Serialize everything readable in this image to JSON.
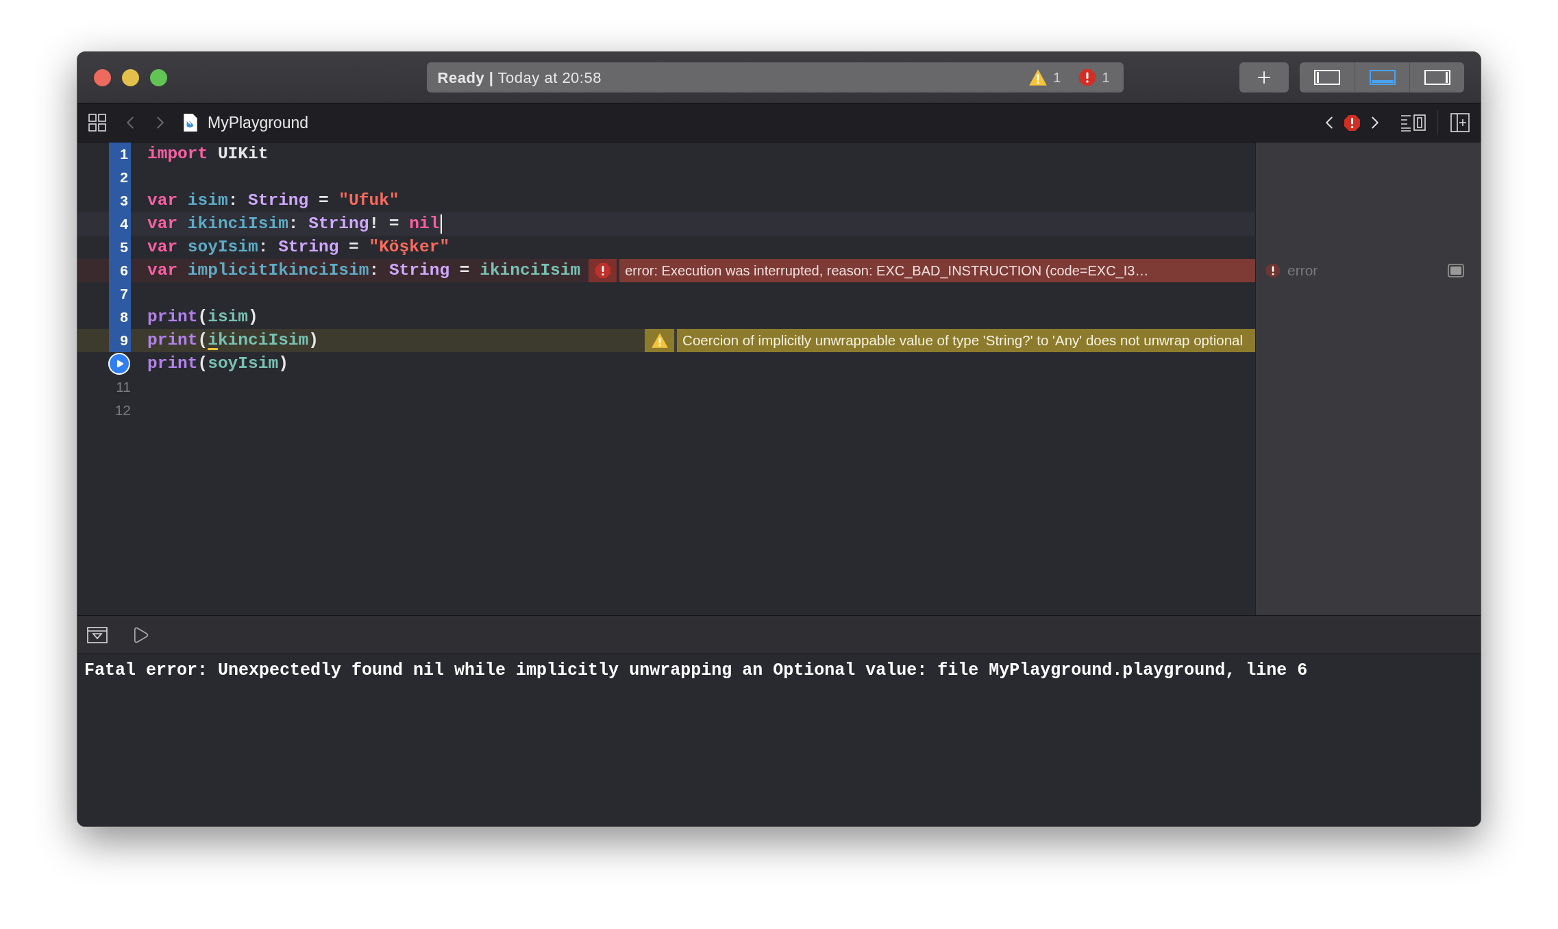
{
  "status": {
    "text": "**Ready |** Today at 20:58",
    "warnings": "1",
    "errors": "1"
  },
  "panels": [
    {
      "kind": "left",
      "selected": false
    },
    {
      "kind": "bottom",
      "selected": true
    },
    {
      "kind": "right",
      "selected": false
    }
  ],
  "breadcrumb": {
    "file": "MyPlayground"
  },
  "editor": {
    "lines": [
      {
        "kind": "code",
        "number": "1",
        "executed": true,
        "current": false,
        "tokens": [
          {
            "text": "import",
            "kind": "keyword"
          },
          {
            "text": " UIKit",
            "kind": "plain"
          }
        ]
      },
      {
        "kind": "code",
        "number": "2",
        "executed": true,
        "current": false
      },
      {
        "kind": "code",
        "number": "3",
        "executed": true,
        "current": false,
        "tokens": [
          {
            "text": "var",
            "kind": "keyword"
          },
          {
            "text": " isim",
            "kind": "declaration"
          },
          {
            "text": ": ",
            "kind": "plain"
          },
          {
            "text": "String",
            "kind": "type"
          },
          {
            "text": " = ",
            "kind": "plain"
          },
          {
            "text": "\"Ufuk\"",
            "kind": "string"
          }
        ]
      },
      {
        "kind": "code",
        "number": "4",
        "executed": true,
        "current": true,
        "tokens": [
          {
            "text": "var",
            "kind": "keyword"
          },
          {
            "text": " ikinciIsim",
            "kind": "declaration"
          },
          {
            "text": ": ",
            "kind": "plain"
          },
          {
            "text": "String",
            "kind": "type"
          },
          {
            "text": "! = ",
            "kind": "plain"
          },
          {
            "text": "nil",
            "kind": "keyword"
          }
        ]
      },
      {
        "kind": "code",
        "number": "5",
        "executed": true,
        "current": false,
        "tokens": [
          {
            "text": "var",
            "kind": "keyword"
          },
          {
            "text": " soyIsim",
            "kind": "declaration"
          },
          {
            "text": ": ",
            "kind": "plain"
          },
          {
            "text": "String",
            "kind": "type"
          },
          {
            "text": " = ",
            "kind": "plain"
          },
          {
            "text": "\"Köşker\"",
            "kind": "string"
          }
        ]
      },
      {
        "kind": "code",
        "number": "6",
        "executed": true,
        "current": false,
        "tokens": [
          {
            "text": "var",
            "kind": "keyword"
          },
          {
            "text": " implicitIkinciIsim",
            "kind": "declaration"
          },
          {
            "text": ": ",
            "kind": "plain"
          },
          {
            "text": "String",
            "kind": "type"
          },
          {
            "text": " = ",
            "kind": "plain"
          },
          {
            "text": "ikinciIsim",
            "kind": "variable"
          }
        ],
        "annotation": {
          "kind": "error",
          "message": "error: Execution was interrupted, reason: EXC_BAD_INSTRUCTION (code=EXC_I3…"
        },
        "result": {
          "kind": "error",
          "text": "error"
        }
      },
      {
        "kind": "code",
        "number": "7",
        "executed": true,
        "current": false
      },
      {
        "kind": "code",
        "number": "8",
        "executed": true,
        "current": false,
        "tokens": [
          {
            "text": "print",
            "kind": "function"
          },
          {
            "text": "(",
            "kind": "plain"
          },
          {
            "text": "isim",
            "kind": "variable"
          },
          {
            "text": ")",
            "kind": "plain"
          }
        ]
      },
      {
        "kind": "code",
        "number": "9",
        "executed": true,
        "current": false,
        "tokens": [
          {
            "text": "print",
            "kind": "function"
          },
          {
            "text": "(",
            "kind": "plain"
          },
          {
            "text": "i",
            "kind": "flagged"
          },
          {
            "text": "kinciIsim",
            "kind": "variable"
          },
          {
            "text": ")",
            "kind": "plain"
          }
        ],
        "annotation": {
          "kind": "warning",
          "message": "Coercion of implicitly unwrappable value of type 'String?' to 'Any' does not unwrap optional"
        }
      },
      {
        "kind": "run",
        "current": false,
        "tokens": [
          {
            "text": "print",
            "kind": "function"
          },
          {
            "text": "(",
            "kind": "plain"
          },
          {
            "text": "soyIsim",
            "kind": "variable"
          },
          {
            "text": ")",
            "kind": "plain"
          }
        ]
      },
      {
        "kind": "code",
        "number": "11",
        "executed": false,
        "current": false
      },
      {
        "kind": "code",
        "number": "12",
        "executed": false,
        "current": false
      }
    ]
  },
  "console": {
    "text": "Fatal error: Unexpectedly found nil while implicitly unwrapping an Optional value: file MyPlayground.playground, line 6"
  }
}
